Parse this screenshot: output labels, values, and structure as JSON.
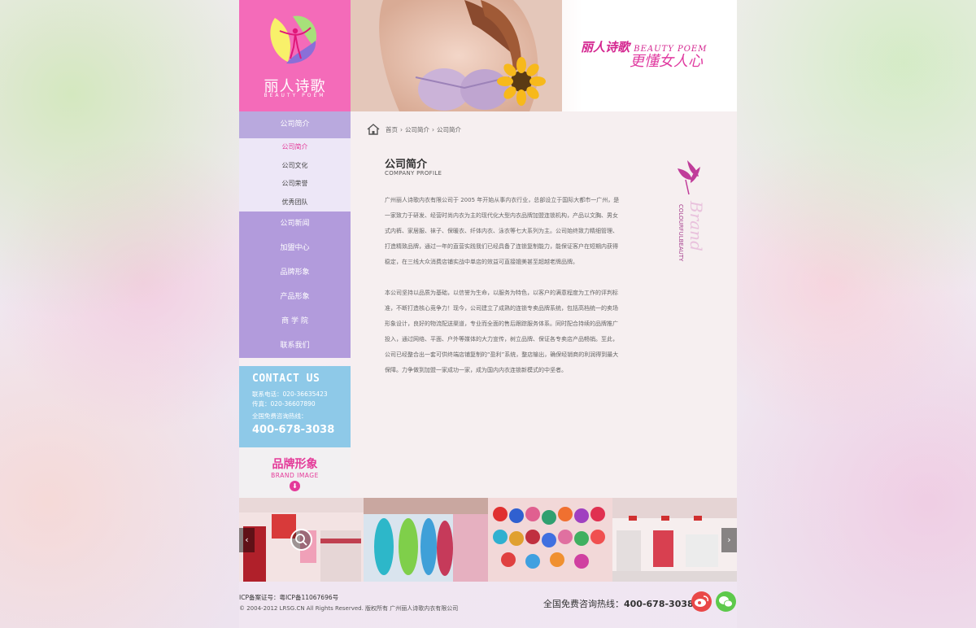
{
  "brand": {
    "logo_cn": "丽人诗歌",
    "logo_en": "BEAUTY POEM",
    "slogan_cn": "丽人诗歌",
    "slogan_en": "BEAUTY POEM",
    "slogan_2": "更懂女人心"
  },
  "sidebar": {
    "section_title": "公司简介",
    "sub_items": [
      "公司简介",
      "公司文化",
      "公司荣誉",
      "优秀团队"
    ],
    "nav_items": [
      "公司新闻",
      "加盟中心",
      "品牌形象",
      "产品形象",
      "商 学 院",
      "联系我们"
    ]
  },
  "contact": {
    "title": "CONTACT US",
    "phone_line": "联系电话：020-36635423",
    "fax_line": "传真：020-36607890",
    "hotline_label": "全国免费咨询热线：",
    "hotline": "400-678-3038"
  },
  "brand_box": {
    "title_cn": "品牌形象",
    "title_en": "BRAND IMAGE",
    "arrow": "⬇"
  },
  "breadcrumb": [
    "首页",
    "公司简介",
    "公司简介"
  ],
  "content": {
    "title": "公司简介",
    "subtitle": "COMPANY PROFILE",
    "paragraph1": "广州丽人诗歌内衣有限公司于 2005 年开始从事内衣行业，总部设立于国际大都市一广州，是一家致力于研发、经营时尚内衣为主的现代化大型内衣品牌加盟连锁机构，产品以文胸、男女式内裤、家居服、袜子、保暖衣、纤体内衣、泳衣等七大系列为主。公司始终致力精细管理、打造精致品牌，通过一年的直营实践我们已经具备了连锁复制能力，能保证客户在短期内获得稳定，在三线大众消费店铺实战中单店的效益可直接媲美甚至超越老牌品牌。",
    "paragraph2": "本公司坚持以品质为基础，以信誉为生命，以服务为特色，以客户的满意程度为工作的评判标准，不断打造核心竞争力！现今，公司建立了成熟的连锁专卖品牌系统，包括高档统一的卖场形象设计，良好的物流配送渠道，专业而全面的售后跟踪服务体系。同时配合持续的品牌推广投入，通过网络、平面、户外等媒体的大力宣传，树立品牌、保证各专卖店产品畅销。至此，公司已经整合出一套可供终端店铺复制的“盈利”系统，整店输出，确保经销商的利润得到最大保障。力争做到加盟一家成功一家，成为国内内衣连锁新模式的中坚者。",
    "deco_text": "COLOURFULBEAUTY"
  },
  "gallery": {
    "prev": "‹",
    "next": "›"
  },
  "footer": {
    "icp": "ICP备案证号：粤ICP备11067696号",
    "copyright": "© 2004-2012 LRSG.CN All Rights Reserved. 版权所有 广州丽人诗歌内衣有限公司",
    "hotline_label": "全国免费咨询热线：",
    "hotline": "400-678-3038"
  }
}
